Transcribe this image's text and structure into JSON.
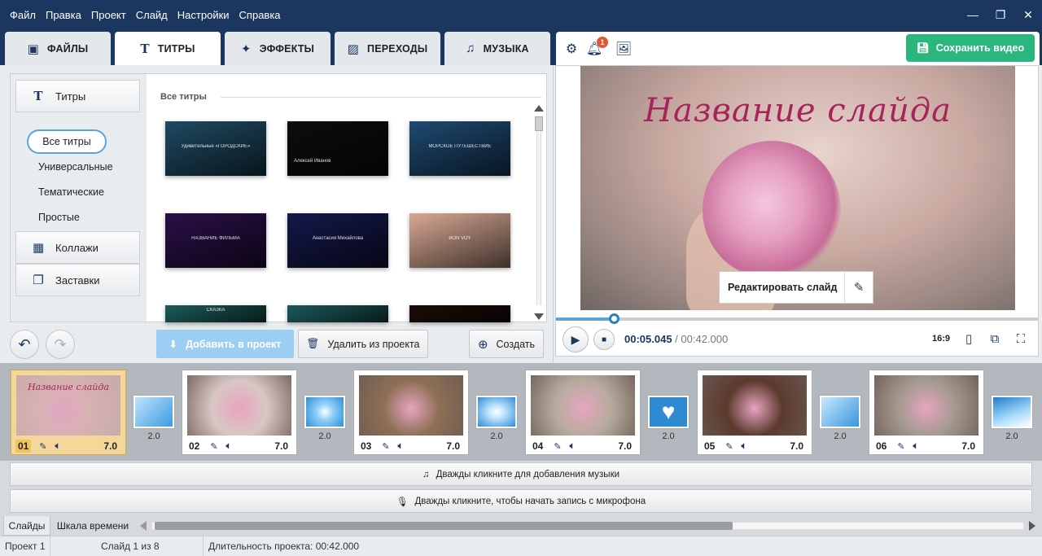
{
  "menu": [
    "Файл",
    "Правка",
    "Проект",
    "Слайд",
    "Настройки",
    "Справка"
  ],
  "window_controls": {
    "minimize": "—",
    "maximize": "❐",
    "close": "✕"
  },
  "tabs": [
    {
      "label": "ФАЙЛЫ",
      "icon": "add-image-icon",
      "glyph": "▣"
    },
    {
      "label": "ТИТРЫ",
      "icon": "text-t-icon",
      "glyph": "T"
    },
    {
      "label": "ЭФФЕКТЫ",
      "icon": "star-icon",
      "glyph": "✦"
    },
    {
      "label": "ПЕРЕХОДЫ",
      "icon": "transition-icon",
      "glyph": "▨"
    },
    {
      "label": "МУЗЫКА",
      "icon": "music-note-icon",
      "glyph": "♫"
    }
  ],
  "toolbar": {
    "notifications_count": "1",
    "save_label": "Сохранить видео"
  },
  "categories": {
    "titles": "Титры",
    "sub": [
      "Все титры",
      "Универсальные",
      "Тематические",
      "Простые"
    ],
    "collages": "Коллажи",
    "intros": "Заставки"
  },
  "gallery": {
    "header": "Все титры",
    "thumbs": [
      {
        "text": "Удивительные «ГОРОДСКИЕ»",
        "bg": "#1f4a62"
      },
      {
        "text": "Алексей Иванов",
        "bg": "#0d0d0f"
      },
      {
        "text": "МОРСКОЕ ПУТЕШЕСТВИЕ",
        "bg": "#1e4a72"
      },
      {
        "text": "НАЗВАНИЕ ФИЛЬМА",
        "bg": "#2a1048"
      },
      {
        "text": "Анастасия Михайлова",
        "bg": "#14184a"
      },
      {
        "text": "BON VOY",
        "bg": "#d9a994"
      },
      {
        "text": "СКАЗКА",
        "bg": "#1b5c5a"
      },
      {
        "text": "",
        "bg": "#1c5a5c"
      },
      {
        "text": "",
        "bg": "#1a0d08"
      }
    ]
  },
  "actions": {
    "add": "Добавить в проект",
    "delete": "Удалить из проекта",
    "create": "Создать"
  },
  "preview": {
    "slide_title": "Название слайда",
    "edit_label": "Редактировать слайд",
    "current_time": "00:05.045",
    "separator": " / ",
    "total_time": "00:42.000",
    "progress": 0.12,
    "ratio": "16:9"
  },
  "slides": [
    {
      "num": "01",
      "duration": "7.0",
      "selected": true,
      "bg": "#d8b4b2"
    },
    {
      "num": "02",
      "duration": "7.0",
      "selected": false,
      "bg": "#d9c6c4"
    },
    {
      "num": "03",
      "duration": "7.0",
      "selected": false,
      "bg": "#8e6f55"
    },
    {
      "num": "04",
      "duration": "7.0",
      "selected": false,
      "bg": "#b7ab9e"
    },
    {
      "num": "05",
      "duration": "7.0",
      "selected": false,
      "bg": "#5c3a2e"
    },
    {
      "num": "06",
      "duration": "7.0",
      "selected": false,
      "bg": "#a49a90"
    }
  ],
  "transitions": [
    "2.0",
    "2.0",
    "2.0",
    "2.0",
    "2.0",
    "2.0"
  ],
  "tracks": {
    "music": "Дважды кликните для добавления музыки",
    "mic": "Дважды кликните, чтобы начать запись с микрофона"
  },
  "bottom_tabs": {
    "slides": "Слайды",
    "timeline": "Шкала времени"
  },
  "status": {
    "project": "Проект 1",
    "slide": "Слайд 1 из 8",
    "duration": "Длительность проекта: 00:42.000"
  },
  "colors": {
    "accent": "#1b3760",
    "save": "#2bb67d",
    "selection": "#f5d79c",
    "brand_title": "#a6245a"
  }
}
